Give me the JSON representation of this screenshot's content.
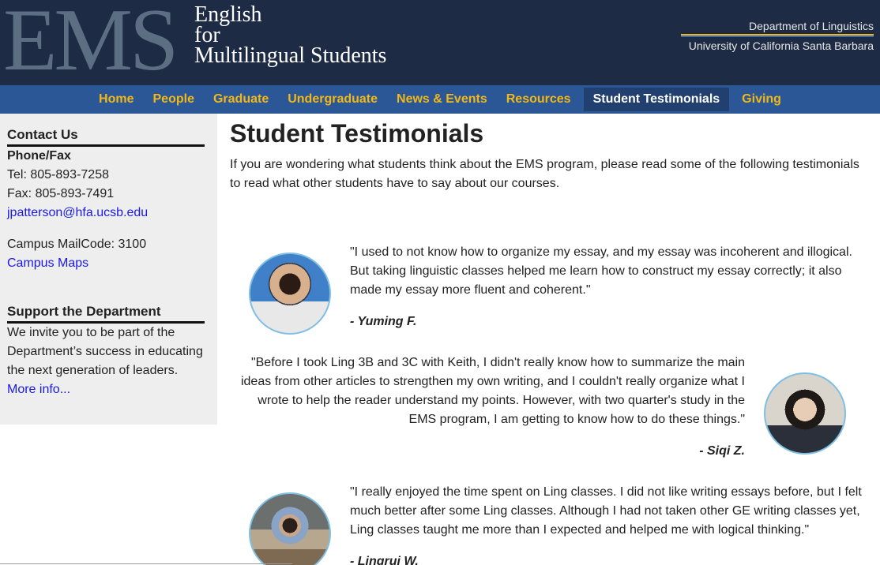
{
  "header": {
    "logo_letters": "EMS",
    "logo_line1": "English",
    "logo_line2": "for",
    "logo_line3": "Multilingual Students",
    "dept_name": "Department of Linguistics",
    "university": "University of California Santa Barbara"
  },
  "nav": {
    "items": [
      "Home",
      "People",
      "Graduate",
      "Undergraduate",
      "News & Events",
      "Resources",
      "Student Testimonials",
      "Giving"
    ],
    "active": "Student Testimonials"
  },
  "sidebar": {
    "contact_heading": "Contact Us",
    "phone_heading": "Phone/Fax",
    "tel": "Tel: 805-893-7258",
    "fax": "Fax: 805-893-7491",
    "email": "jpatterson@hfa.ucsb.edu",
    "mailcode": "Campus MailCode: 3100",
    "maps_link": "Campus Maps",
    "support_heading": "Support the Department",
    "support_text": "We invite you to be part of the Department’s success in educating the next generation of leaders.",
    "more_link": "More info..."
  },
  "main": {
    "title": "Student Testimonials",
    "intro": "If you are wondering what students think about the EMS program, please read some of the following testimonials to read what other students have to say about our courses.",
    "testimonials": [
      {
        "quote": "\"I used to not know how to organize my essay, and my essay was incoherent and illogical. But taking linguistic classes helped me learn how to construct my essay correctly; it also made my essay more fluent and coherent.\"",
        "author": "- Yuming F."
      },
      {
        "quote": "\"Before I took Ling 3B and 3C with Keith, I didn't really know how to summarize the main ideas from other articles to strengthen my own writing, and I couldn't really organize what I wrote to help the reader understand my points. However, with two quarter's study in the EMS program, I am getting to know how to do these things.\"",
        "author": "- Siqi Z."
      },
      {
        "quote": "\"I really enjoyed the time spent on Ling classes. I did not like writing essays before, but I felt much better after some Ling classes. Although I had not taken other GE writing classes yet, Ling classes taught me more than I expected and helped me with logical thinking.\"",
        "author": "- Lingrui W."
      }
    ]
  }
}
